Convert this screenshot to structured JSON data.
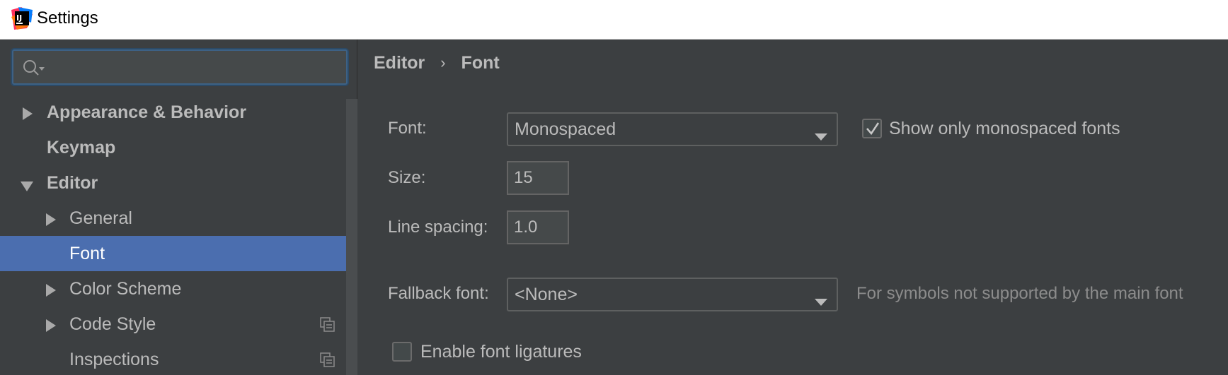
{
  "window": {
    "title": "Settings",
    "icon": "intellij-idea-logo"
  },
  "search": {
    "placeholder": "",
    "value": ""
  },
  "sidebar": {
    "items": [
      {
        "label": "Appearance & Behavior",
        "expander": "collapsed",
        "bold": true
      },
      {
        "label": "Keymap",
        "expander": "none",
        "bold": true
      },
      {
        "label": "Editor",
        "expander": "expanded",
        "bold": true
      },
      {
        "label": "General",
        "expander": "collapsed",
        "bold": false
      },
      {
        "label": "Font",
        "expander": "none",
        "bold": false,
        "selected": true
      },
      {
        "label": "Color Scheme",
        "expander": "collapsed",
        "bold": false
      },
      {
        "label": "Code Style",
        "expander": "collapsed",
        "bold": false,
        "icon": "copy-icon"
      },
      {
        "label": "Inspections",
        "expander": "none",
        "bold": false,
        "icon": "copy-icon"
      }
    ]
  },
  "breadcrumb": {
    "parent": "Editor",
    "separator": "›",
    "current": "Font"
  },
  "form": {
    "font_label": "Font:",
    "font_value": "Monospaced",
    "show_mono_label": "Show only monospaced fonts",
    "show_mono_checked": true,
    "size_label": "Size:",
    "size_value": "15",
    "line_spacing_label": "Line spacing:",
    "line_spacing_value": "1.0",
    "fallback_label": "Fallback font:",
    "fallback_value": "<None>",
    "fallback_hint": "For symbols not supported by the main font",
    "ligatures_label": "Enable font ligatures",
    "ligatures_checked": false
  },
  "colors": {
    "background": "#3c3f41",
    "selection": "#4b6eaf",
    "text": "#bbbbbb",
    "focus_border": "#3d6185"
  }
}
